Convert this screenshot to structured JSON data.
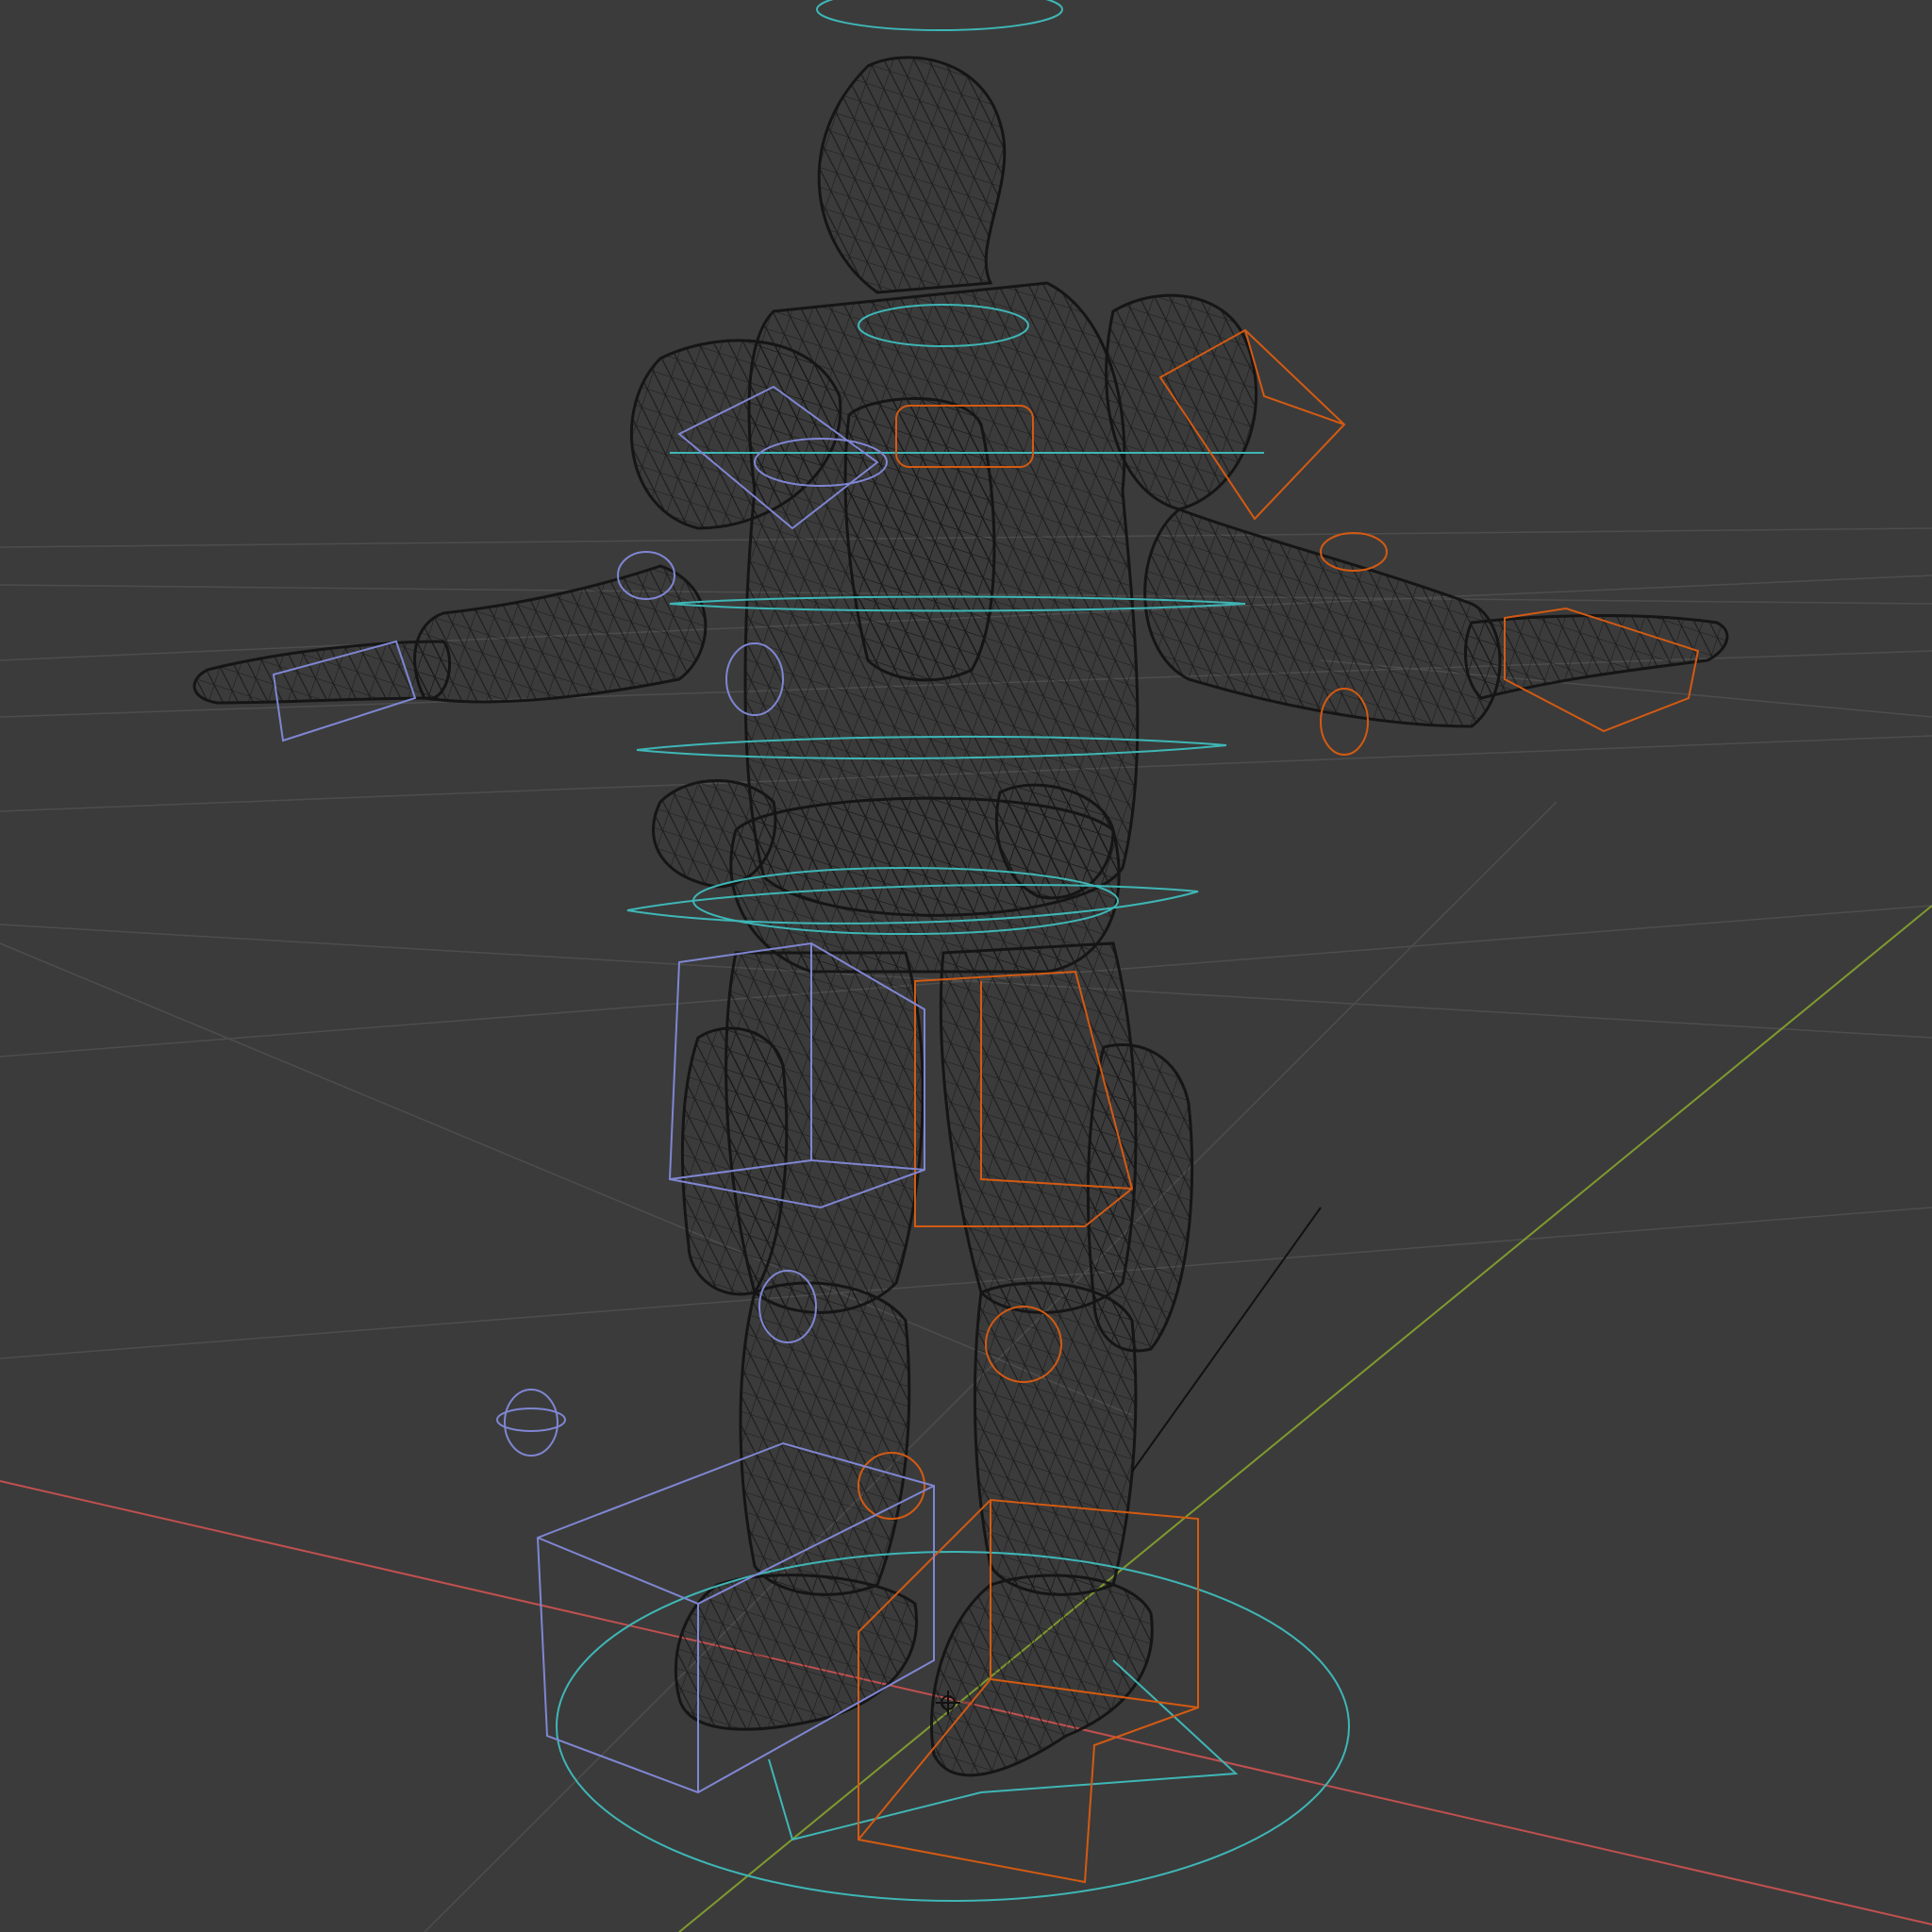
{
  "viewport": {
    "view": "3d-viewport",
    "shading": "wireframe",
    "background_color": "#3b3b3b",
    "grid_line_color": "#505050",
    "x_axis_color": "#c0504f",
    "y_axis_color": "#7f9a2e",
    "mesh_wire_color": "#111111",
    "controls": {
      "cyan": "#3fb6b6",
      "orange": "#d35a12",
      "blue": "#7f86d2"
    }
  },
  "scene": {
    "object": "armored-character-mesh",
    "pose": "t-pose",
    "rig": "control-rig"
  }
}
